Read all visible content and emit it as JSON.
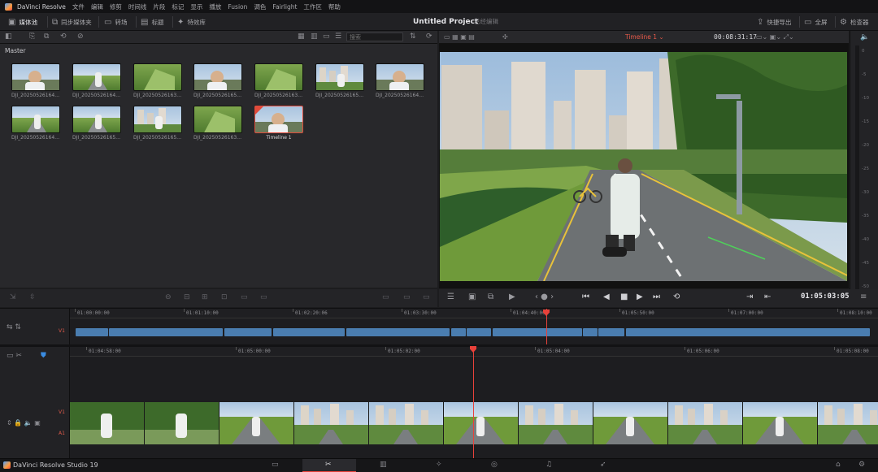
{
  "menubar": {
    "app_name": "DaVinci Resolve",
    "items": [
      "文件",
      "编辑",
      "修剪",
      "时间线",
      "片段",
      "标记",
      "显示",
      "播放",
      "Fusion",
      "调色",
      "Fairlight",
      "工作区",
      "帮助"
    ]
  },
  "toolbar": {
    "left": [
      {
        "label": "媒体池",
        "icon": "media-pool-icon"
      },
      {
        "label": "同步媒体夹",
        "icon": "sync-bin-icon"
      },
      {
        "label": "转场",
        "icon": "transitions-icon"
      },
      {
        "label": "标题",
        "icon": "titles-icon"
      },
      {
        "label": "特效库",
        "icon": "effects-icon"
      }
    ],
    "project_title": "Untitled Project",
    "project_status": "已经编辑",
    "right": [
      {
        "label": "快捷导出",
        "icon": "quick-export-icon"
      },
      {
        "label": "全屏",
        "icon": "fullscreen-icon"
      },
      {
        "label": "检查器",
        "icon": "inspector-icon"
      }
    ]
  },
  "media_pool": {
    "search_placeholder": "搜索",
    "bin_name": "Master",
    "clips": [
      {
        "label": "DJI_202505261644...",
        "scene": "selfie"
      },
      {
        "label": "DJI_202505261645...",
        "scene": "road"
      },
      {
        "label": "DJI_202505261634...",
        "scene": "grass"
      },
      {
        "label": "DJI_202505261651...",
        "scene": "selfie"
      },
      {
        "label": "DJI_202505261635...",
        "scene": "grass"
      },
      {
        "label": "DJI_202505261653...",
        "scene": "city"
      },
      {
        "label": "DJI_202505261646...",
        "scene": "selfie"
      },
      {
        "label": "DJI_202505261642...",
        "scene": "road"
      },
      {
        "label": "DJI_202505261653...",
        "scene": "road"
      },
      {
        "label": "DJI_202505261653...",
        "scene": "city"
      },
      {
        "label": "DJI_202505261637...",
        "scene": "grass"
      },
      {
        "label": "Timeline 1",
        "scene": "selfie",
        "selected": true
      }
    ]
  },
  "viewer": {
    "timeline_name": "Timeline 1",
    "duration_timecode": "00:08:31:17",
    "current_timecode": "01:05:03:05"
  },
  "audio_meter": {
    "ticks": [
      "0",
      "-5",
      "-10",
      "-15",
      "-20",
      "-25",
      "-30",
      "-35",
      "-40",
      "-45",
      "-50"
    ]
  },
  "timeline": {
    "upper_ruler": [
      "01:00:00:00",
      "01:01:10:00",
      "01:02:20:06",
      "01:03:30:00",
      "01:04:40:00",
      "01:05:50:00",
      "01:07:00:00",
      "01:08:10:00"
    ],
    "lower_ruler": [
      "01:04:58:00",
      "01:05:00:00",
      "01:05:02:00",
      "01:05:04:00",
      "01:05:06:00",
      "01:05:08:00"
    ],
    "video_track": "V1",
    "audio_track": "A1"
  },
  "bottom_bar": {
    "brand": "DaVinci Resolve Studio 19",
    "pages": [
      "media-page-icon",
      "cut-page-icon",
      "edit-page-icon",
      "fusion-page-icon",
      "color-page-icon",
      "fairlight-page-icon",
      "deliver-page-icon"
    ],
    "active_page": 1
  },
  "colors": {
    "accent": "#e8413a",
    "clip_blue": "#4a7db0",
    "panel": "#28282b"
  }
}
